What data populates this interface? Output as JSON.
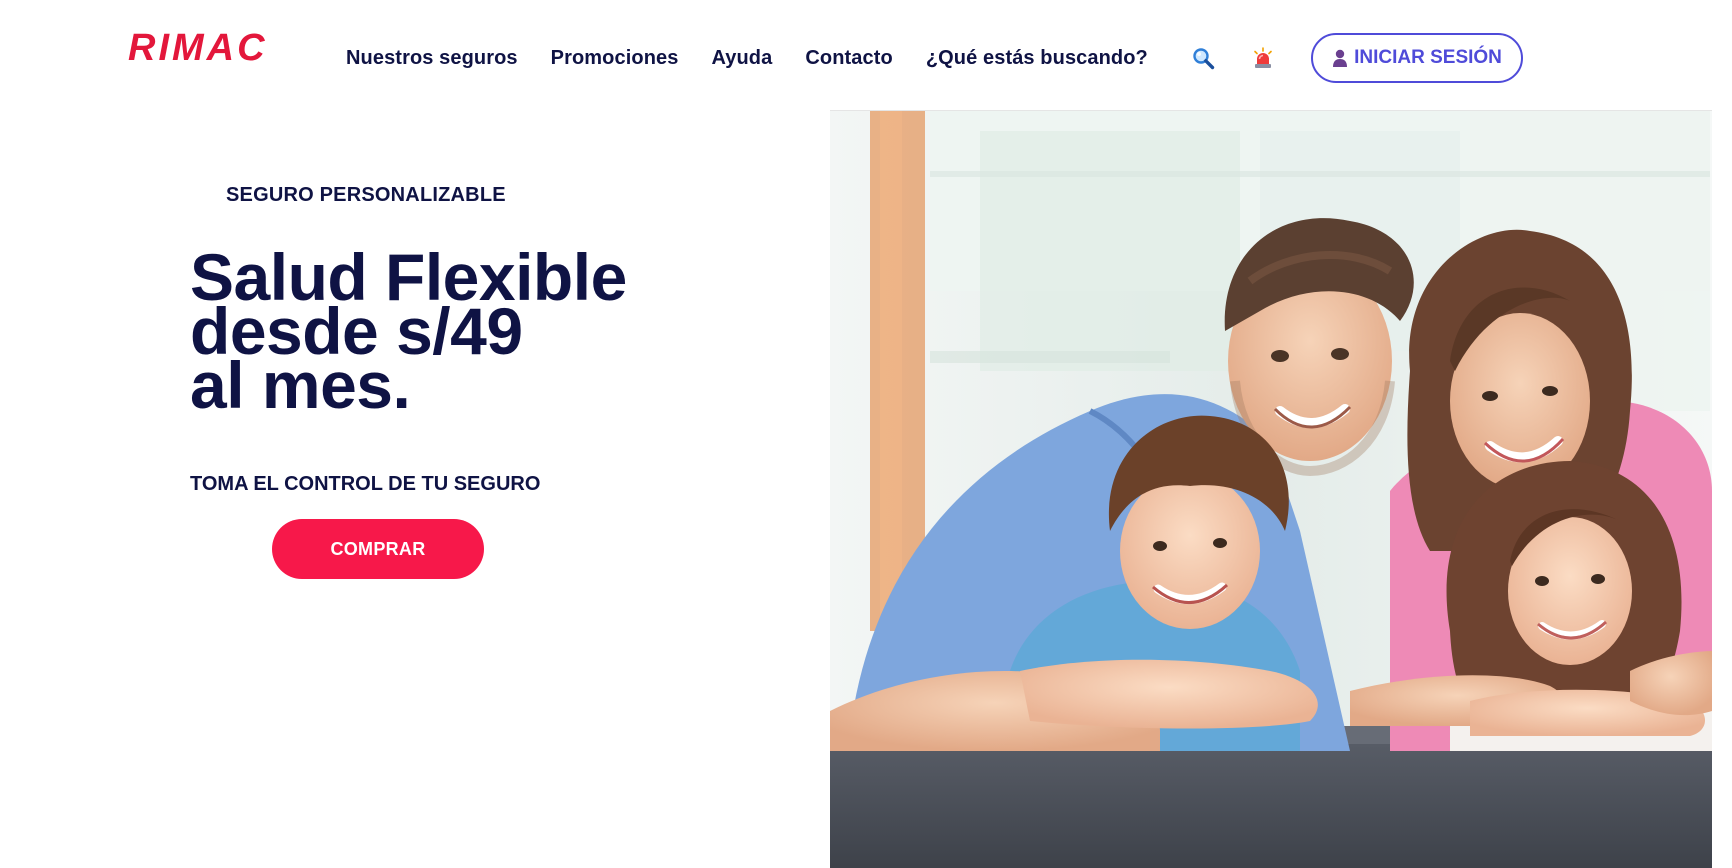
{
  "brand": {
    "logo_text": "RIMAC",
    "color": "#e3173b"
  },
  "nav": {
    "items": [
      {
        "label": "Nuestros seguros"
      },
      {
        "label": "Promociones"
      },
      {
        "label": "Ayuda"
      },
      {
        "label": "Contacto"
      },
      {
        "label": "¿Qué estás buscando?"
      }
    ]
  },
  "header": {
    "search_icon": "magnifier-icon",
    "alert_icon": "siren-icon",
    "login_label": "INICIAR SESIÓN",
    "login_icon": "user-icon",
    "login_color": "#4f4bd9"
  },
  "hero": {
    "eyebrow": "SEGURO PERSONALIZABLE",
    "title_lines": [
      "Salud Flexible",
      "desde s/49",
      "al mes."
    ],
    "subtitle": "TOMA EL CONTROL DE TU SEGURO",
    "cta_label": "COMPRAR",
    "cta_color": "#f7184a",
    "text_color": "#0f1344",
    "image": "family-photo"
  }
}
